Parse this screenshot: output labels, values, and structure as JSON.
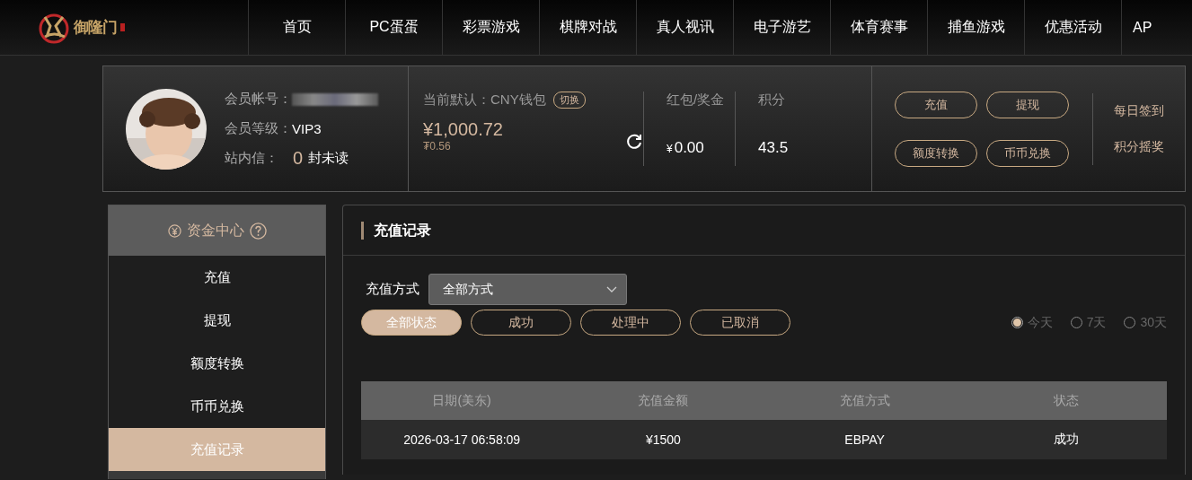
{
  "header": {
    "logo_text": "御隆门",
    "nav": [
      {
        "label": "首页"
      },
      {
        "label": "PC蛋蛋"
      },
      {
        "label": "彩票游戏"
      },
      {
        "label": "棋牌对战"
      },
      {
        "label": "真人视讯"
      },
      {
        "label": "电子游艺"
      },
      {
        "label": "体育赛事"
      },
      {
        "label": "捕鱼游戏"
      },
      {
        "label": "优惠活动"
      },
      {
        "label": "AP"
      }
    ]
  },
  "profile": {
    "avatar": {
      "kind": "picture"
    },
    "account_label": "会员帐号：",
    "level_label": "会员等级：",
    "level_value": "VIP3",
    "messages_label": "站内信：",
    "messages_count": "0",
    "messages_suffix": "封未读",
    "wallet_label": "当前默认：CNY钱包",
    "switch_button": "切换",
    "balance": "¥1,000.72",
    "sub_balance": "₮0.56",
    "bonus_label": "红包/奖金",
    "bonus_currency": "¥",
    "bonus_value": "0.00",
    "points_label": "积分",
    "points_value": "43.5",
    "actions": [
      "充值",
      "提现",
      "额度转换",
      "币币兑换"
    ],
    "links": [
      "每日签到",
      "积分摇奖"
    ]
  },
  "sidebar": {
    "title": "资金中心",
    "items": [
      {
        "label": "充值",
        "selected": false
      },
      {
        "label": "提现",
        "selected": false
      },
      {
        "label": "额度转换",
        "selected": false
      },
      {
        "label": "币币兑换",
        "selected": false
      },
      {
        "label": "充值记录",
        "selected": true
      }
    ]
  },
  "panel": {
    "title": "充值记录",
    "method_label": "充值方式",
    "method_value": "全部方式",
    "status_filters": [
      {
        "label": "全部状态",
        "selected": true
      },
      {
        "label": "成功",
        "selected": false
      },
      {
        "label": "处理中",
        "selected": false
      },
      {
        "label": "已取消",
        "selected": false
      }
    ],
    "periods": [
      {
        "label": "今天",
        "selected": true
      },
      {
        "label": "7天",
        "selected": false
      },
      {
        "label": "30天",
        "selected": false
      }
    ],
    "table": {
      "columns": [
        "日期(美东)",
        "充值金额",
        "充值方式",
        "状态"
      ],
      "rows": [
        [
          "2026-03-17 06:58:09",
          "¥1500",
          "EBPAY",
          "成功"
        ]
      ]
    }
  }
}
